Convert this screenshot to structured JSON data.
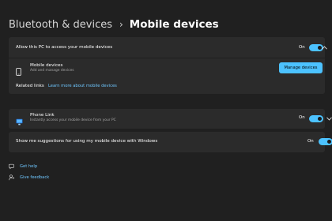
{
  "breadcrumb": {
    "parent": "Bluetooth & devices",
    "separator": "›",
    "current": "Mobile devices"
  },
  "access_card": {
    "label": "Allow this PC to access your mobile devices",
    "state": "On",
    "mobile_devices": {
      "title": "Mobile devices",
      "subtitle": "Add and manage devices",
      "button": "Manage devices"
    },
    "related_links": {
      "label": "Related links",
      "link": "Learn more about mobile devices"
    }
  },
  "phone_link": {
    "title": "Phone Link",
    "subtitle": "Instantly access your mobile device from your PC",
    "state": "On"
  },
  "suggestions": {
    "label": "Show me suggestions for using my mobile device with Windows",
    "state": "On"
  },
  "footer": {
    "get_help": "Get help",
    "give_feedback": "Give feedback"
  },
  "colors": {
    "accent": "#4cc2ff",
    "card": "#2b2b2b",
    "background": "#202020"
  },
  "icons": {
    "phone": "phone-icon",
    "phone_link": "phone-link-icon",
    "help": "help-icon",
    "feedback": "feedback-icon"
  }
}
